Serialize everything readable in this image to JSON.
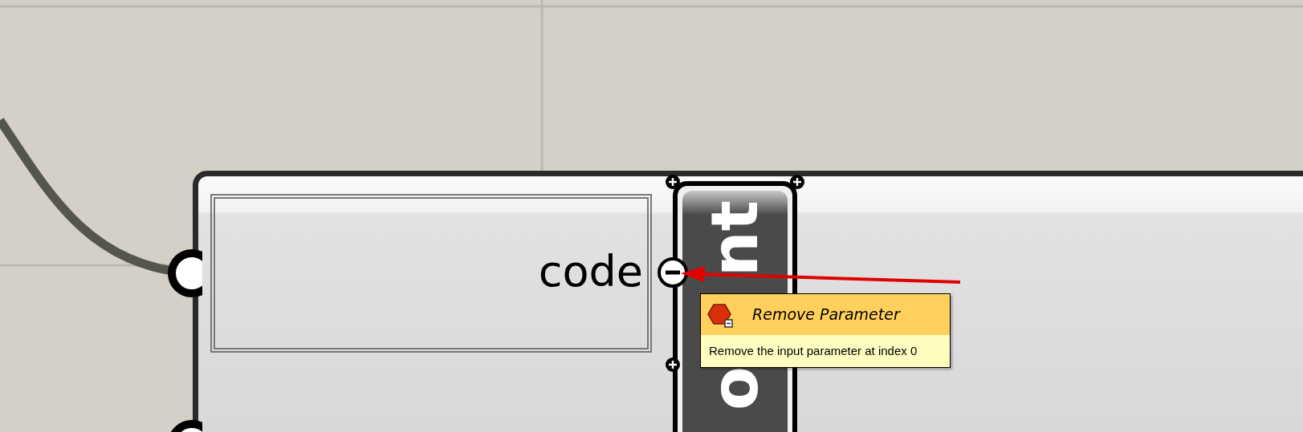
{
  "component": {
    "input": "code",
    "name_upper": "nt",
    "name_lower": "o"
  },
  "tooltip": {
    "title": "Remove Parameter",
    "description": "Remove the input parameter at index 0"
  }
}
